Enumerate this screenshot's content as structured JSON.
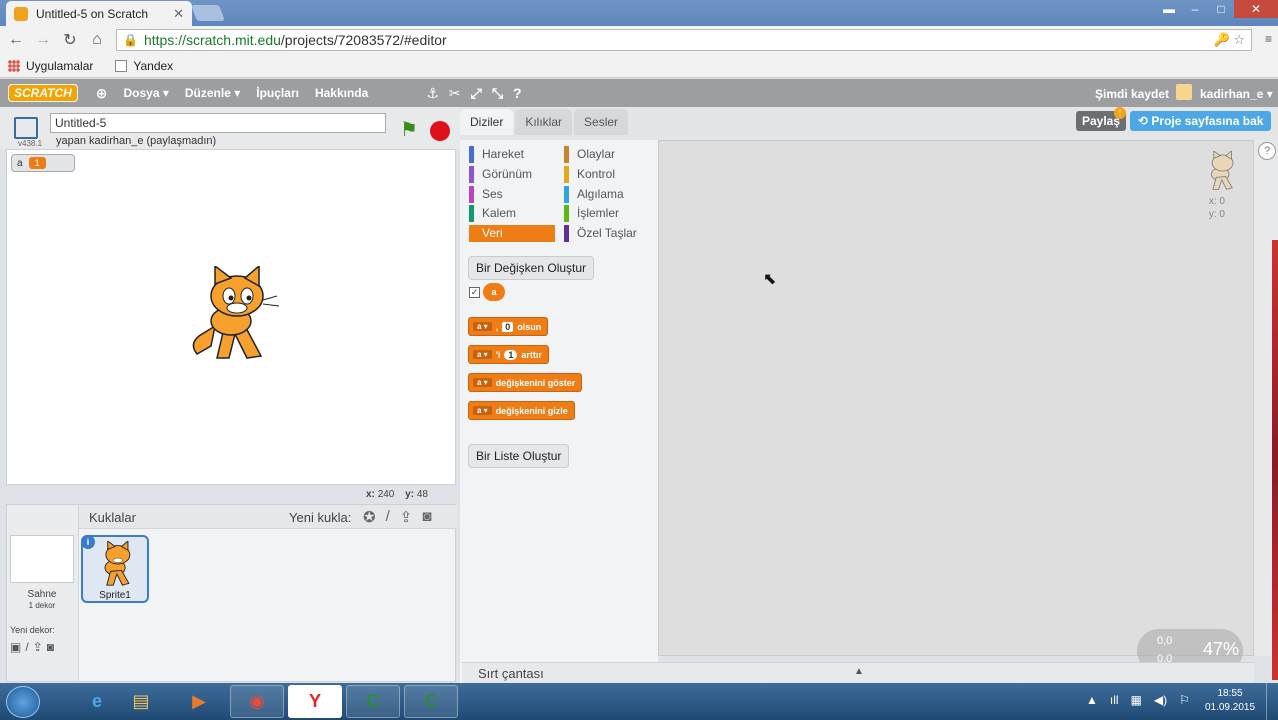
{
  "browser": {
    "tab_title": "Untitled-5 on Scratch",
    "tab_close": "✕",
    "url_host": "https://scratch.mit.edu",
    "url_path": "/projects/72083572/#editor",
    "bookmarks": [
      "Uygulamalar",
      "Yandex"
    ]
  },
  "menubar": {
    "logo": "SCRATCH",
    "items": [
      "Dosya ▾",
      "Düzenle ▾",
      "İpuçları",
      "Hakkında"
    ],
    "save_now": "Şimdi kaydet",
    "username": "kadirhan_e ▾"
  },
  "stage": {
    "version": "v438.1",
    "project_title": "Untitled-5",
    "byline": "yapan kadirhan_e (paylaşmadın)",
    "var_name": "a",
    "var_value": "1",
    "x_label": "x:",
    "x_value": "240",
    "y_label": "y:",
    "y_value": "48"
  },
  "sprites": {
    "header": "Kuklalar",
    "new_sprite": "Yeni kukla:",
    "stage_label": "Sahne",
    "stage_count": "1 dekor",
    "new_backdrop": "Yeni dekor:",
    "sprite_name": "Sprite1",
    "info": "i"
  },
  "palette": {
    "tabs": [
      "Diziler",
      "Kılıklar",
      "Sesler"
    ],
    "categories": [
      {
        "label": "Hareket",
        "color": "#4a6cd4"
      },
      {
        "label": "Olaylar",
        "color": "#c88330"
      },
      {
        "label": "Görünüm",
        "color": "#8a55d7"
      },
      {
        "label": "Kontrol",
        "color": "#e1a91a"
      },
      {
        "label": "Ses",
        "color": "#bb42c3"
      },
      {
        "label": "Algılama",
        "color": "#2ca5e2"
      },
      {
        "label": "Kalem",
        "color": "#0e9a6c"
      },
      {
        "label": "İşlemler",
        "color": "#5cb712"
      },
      {
        "label": "Veri",
        "color": "#ee7d16"
      },
      {
        "label": "Özel Taşlar",
        "color": "#632d99"
      }
    ],
    "make_variable": "Bir Değişken Oluştur",
    "reporter": "a",
    "block_set": {
      "var": "a ▾",
      "mid": ",",
      "value": "0",
      "end": "olsun"
    },
    "block_change": {
      "var": "a ▾",
      "mid": "'i",
      "value": "1",
      "end": "arttır"
    },
    "block_show": {
      "var": "a ▾",
      "end": "değişkenini göster"
    },
    "block_hide": {
      "var": "a ▾",
      "end": "değişkenini gizle"
    },
    "make_list": "Bir Liste Oluştur"
  },
  "script": {
    "share": "Paylaş",
    "share_badge": "!",
    "project_page": "Proje sayfasına bak",
    "sprite_x": "x: 0",
    "sprite_y": "y: 0",
    "zoom_a": "0,0",
    "zoom_b": "0,0",
    "zoom_pct": "47%",
    "help": "?"
  },
  "backpack": {
    "label": "Sırt çantası",
    "arrow": "▲"
  },
  "taskbar": {
    "clock_time": "18:55",
    "clock_date": "01.09.2015"
  }
}
